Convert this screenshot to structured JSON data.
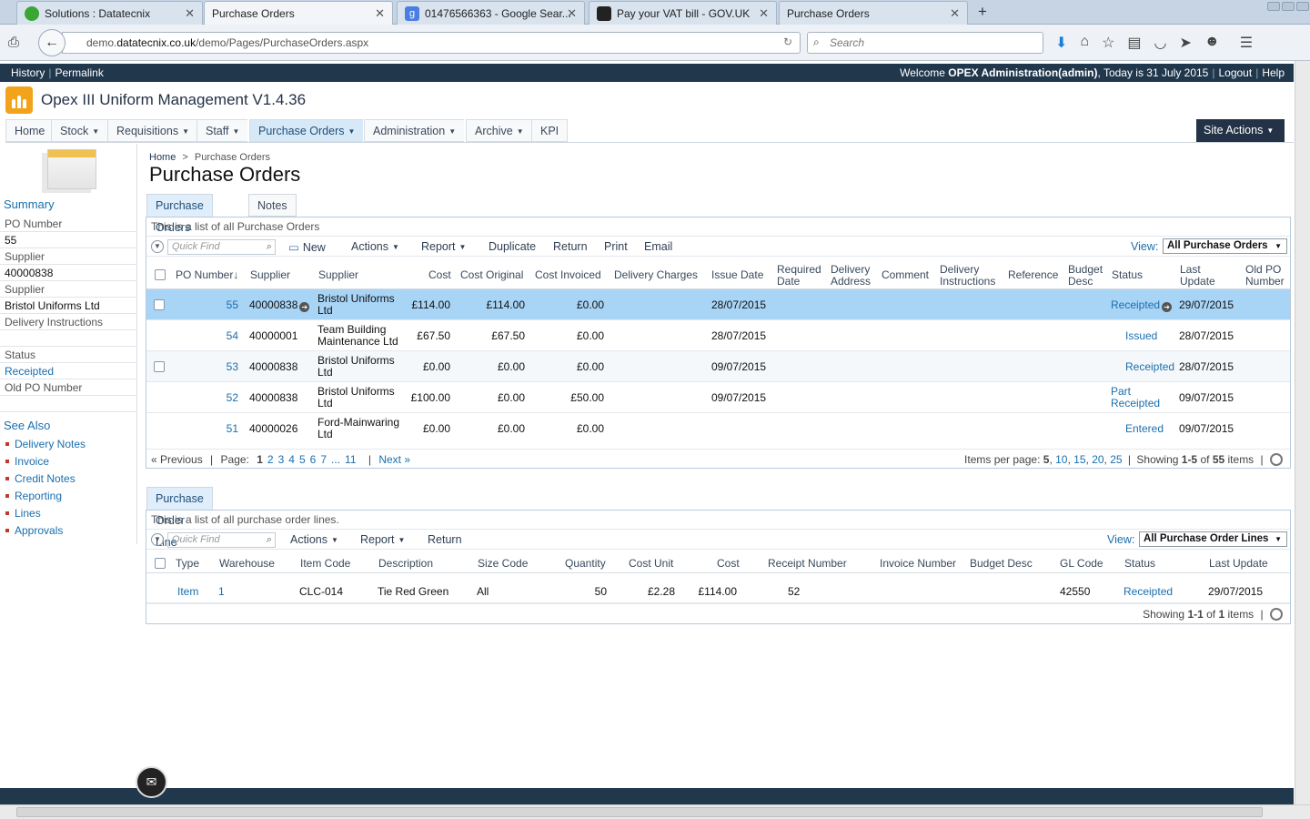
{
  "browser": {
    "tabs": [
      {
        "label": "Solutions : Datatecnix",
        "favicon": "green-globe"
      },
      {
        "label": "Purchase Orders",
        "favicon": "none"
      },
      {
        "label": "01476566363 - Google Sear...",
        "favicon": "google-g"
      },
      {
        "label": "Pay your VAT bill - GOV.UK",
        "favicon": "crown"
      },
      {
        "label": "Purchase Orders",
        "favicon": "none"
      }
    ],
    "url_prefix": "demo.",
    "url_domain": "datatecnix.co.uk",
    "url_path": "/demo/Pages/PurchaseOrders.aspx",
    "search_placeholder": "Search"
  },
  "topstrip": {
    "history": "History",
    "permalink": "Permalink",
    "welcome_prefix": "Welcome ",
    "user": "OPEX Administration(admin)",
    "date_text": ", Today is 31 July 2015",
    "logout": "Logout",
    "help": "Help"
  },
  "site": {
    "title": "Opex III Uniform Management V1.4.36",
    "menu": [
      "Home",
      "Stock",
      "Requisitions",
      "Staff",
      "Purchase Orders",
      "Administration",
      "Archive",
      "KPI"
    ],
    "site_actions": "Site Actions"
  },
  "leftnav": {
    "summary": "Summary",
    "fields": [
      {
        "label": "PO Number",
        "value": "55"
      },
      {
        "label": "Supplier",
        "value": "40000838"
      },
      {
        "label": "Supplier",
        "value": "Bristol Uniforms Ltd"
      },
      {
        "label": "Delivery Instructions",
        "value": ""
      },
      {
        "label": "Status",
        "value": "Receipted"
      },
      {
        "label": "Old PO Number",
        "value": ""
      }
    ],
    "see_also": "See Also",
    "links": [
      "Delivery Notes",
      "Invoice",
      "Credit Notes",
      "Reporting",
      "Lines",
      "Approvals"
    ]
  },
  "page": {
    "breadcrumb_home": "Home",
    "breadcrumb_sep": ">",
    "breadcrumb_current": "Purchase Orders",
    "title": "Purchase Orders"
  },
  "po_panel": {
    "tabs": [
      "Purchase Orders",
      "Notes"
    ],
    "description": "This is a list of all Purchase Orders",
    "quickfind_placeholder": "Quick Find",
    "toolbar": [
      "New",
      "Actions",
      "Report",
      "Duplicate",
      "Return",
      "Print",
      "Email"
    ],
    "view_label": "View:",
    "view_value": "All Purchase Orders",
    "columns": [
      "PO Number↓",
      "Supplier",
      "Supplier",
      "Cost",
      "Cost Original",
      "Cost Invoiced",
      "Delivery Charges",
      "Issue Date",
      "Required Date",
      "Delivery Address",
      "Comment",
      "Delivery Instructions",
      "Reference",
      "Budget Desc",
      "Status",
      "Last Update",
      "Old PO Number"
    ],
    "rows": [
      {
        "po": "55",
        "supplier_code": "40000838",
        "supplier": "Bristol Uniforms Ltd",
        "cost": "£114.00",
        "cost_original": "£114.00",
        "cost_invoiced": "£0.00",
        "issue_date": "28/07/2015",
        "status": "Receipted",
        "last_update": "29/07/2015"
      },
      {
        "po": "54",
        "supplier_code": "40000001",
        "supplier": "Team Building Maintenance Ltd",
        "cost": "£67.50",
        "cost_original": "£67.50",
        "cost_invoiced": "£0.00",
        "issue_date": "28/07/2015",
        "status": "Issued",
        "last_update": "28/07/2015"
      },
      {
        "po": "53",
        "supplier_code": "40000838",
        "supplier": "Bristol Uniforms Ltd",
        "cost": "£0.00",
        "cost_original": "£0.00",
        "cost_invoiced": "£0.00",
        "issue_date": "09/07/2015",
        "status": "Receipted",
        "last_update": "28/07/2015"
      },
      {
        "po": "52",
        "supplier_code": "40000838",
        "supplier": "Bristol Uniforms Ltd",
        "cost": "£100.00",
        "cost_original": "£0.00",
        "cost_invoiced": "£50.00",
        "issue_date": "09/07/2015",
        "status": "Part Receipted",
        "last_update": "09/07/2015"
      },
      {
        "po": "51",
        "supplier_code": "40000026",
        "supplier": "Ford-Mainwaring Ltd",
        "cost": "£0.00",
        "cost_original": "£0.00",
        "cost_invoiced": "£0.00",
        "issue_date": "",
        "status": "Entered",
        "last_update": "09/07/2015"
      }
    ],
    "pager": {
      "previous": "« Previous",
      "page_label": "Page:",
      "current": "1",
      "pages": [
        "2",
        "3",
        "4",
        "5",
        "6",
        "7",
        "...",
        "11"
      ],
      "next": "Next »",
      "items_per_page_label": "Items per page:",
      "sizes": [
        "5",
        "10",
        "15",
        "20",
        "25"
      ],
      "showing_label": "Showing",
      "range": "1-5",
      "of": "of",
      "total": "55",
      "items": "items"
    }
  },
  "pol_panel": {
    "tab": "Purchase Order Line",
    "description": "This is a list of all purchase order lines.",
    "quickfind_placeholder": "Quick Find",
    "toolbar": [
      "Actions",
      "Report",
      "Return"
    ],
    "view_label": "View:",
    "view_value": "All Purchase Order Lines",
    "columns": [
      "Type",
      "Warehouse",
      "Item Code",
      "Description",
      "Size Code",
      "Quantity",
      "Cost Unit",
      "Cost",
      "Receipt Number",
      "Invoice Number",
      "Budget Desc",
      "GL Code",
      "Status",
      "Last Update"
    ],
    "rows": [
      {
        "type": "Item",
        "warehouse": "1",
        "item_code": "CLC-014",
        "description": "Tie Red Green",
        "size_code": "All",
        "quantity": "50",
        "cost_unit": "£2.28",
        "cost": "£114.00",
        "receipt_number": "52",
        "gl_code": "42550",
        "status": "Receipted",
        "last_update": "29/07/2015"
      }
    ],
    "footer": {
      "showing_label": "Showing",
      "range": "1-1",
      "of": "of",
      "total": "1",
      "items": "items"
    }
  }
}
